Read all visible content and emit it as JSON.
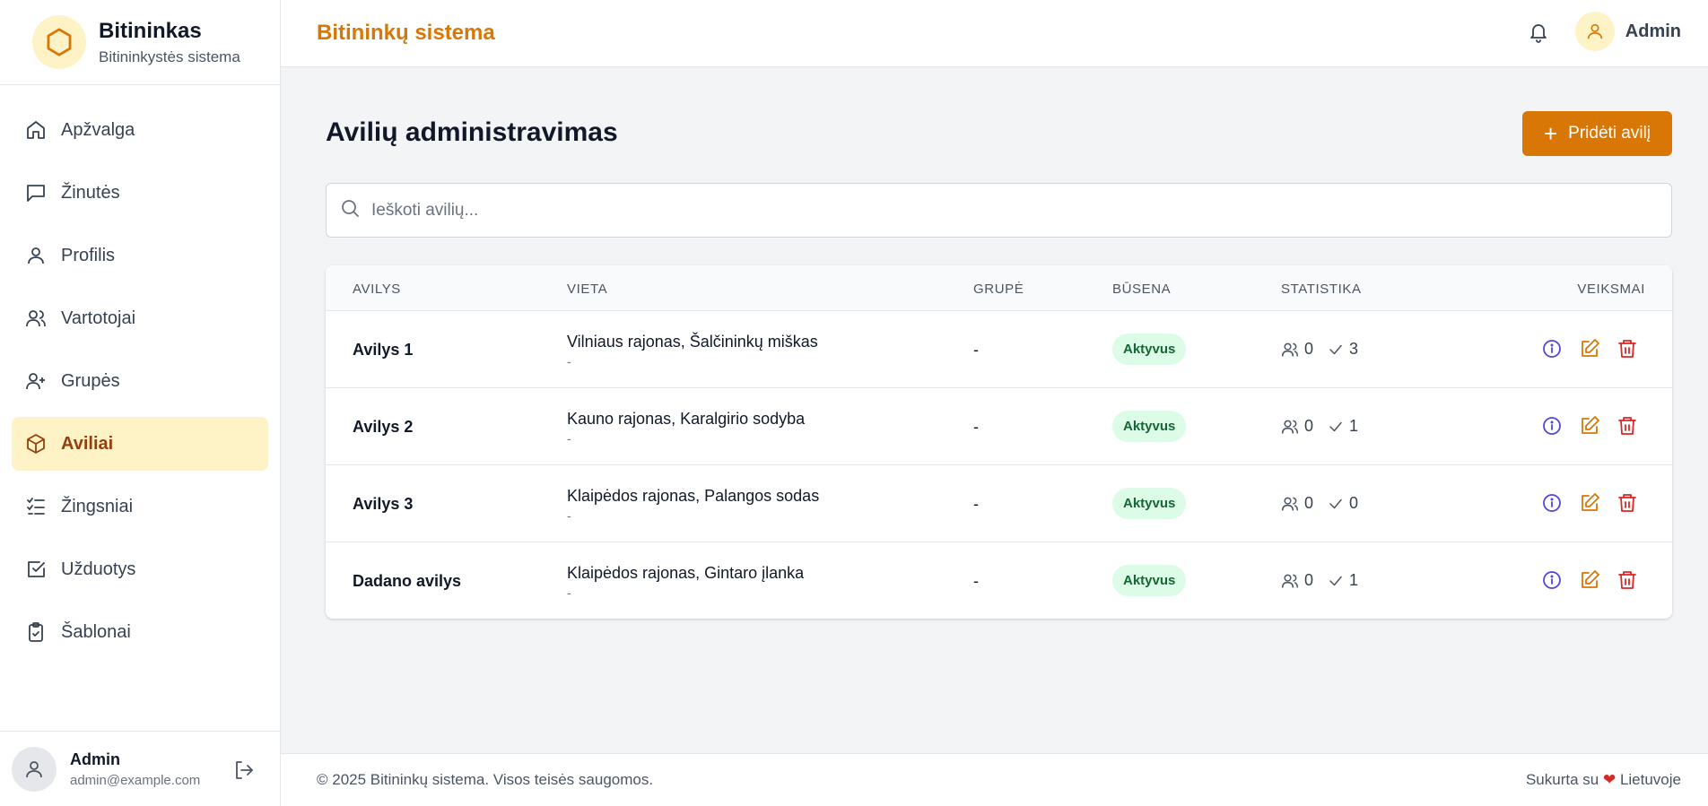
{
  "brand": {
    "name": "Bitininkas",
    "subtitle": "Bitininkystės sistema",
    "accent": "#d97706"
  },
  "sidebar": {
    "items": [
      {
        "label": "Apžvalga",
        "icon": "home-icon",
        "active": false
      },
      {
        "label": "Žinutės",
        "icon": "message-icon",
        "active": false
      },
      {
        "label": "Profilis",
        "icon": "user-icon",
        "active": false
      },
      {
        "label": "Vartotojai",
        "icon": "users-icon",
        "active": false
      },
      {
        "label": "Grupės",
        "icon": "user-plus-icon",
        "active": false
      },
      {
        "label": "Aviliai",
        "icon": "box-icon",
        "active": true
      },
      {
        "label": "Žingsniai",
        "icon": "list-checks-icon",
        "active": false
      },
      {
        "label": "Užduotys",
        "icon": "square-check-icon",
        "active": false
      },
      {
        "label": "Šablonai",
        "icon": "clipboard-check-icon",
        "active": false
      }
    ],
    "user": {
      "name": "Admin",
      "email": "admin@example.com"
    }
  },
  "header": {
    "title": "Bitininkų sistema",
    "username": "Admin"
  },
  "main": {
    "title": "Avilių administravimas",
    "add_button": "Pridėti avilį",
    "search_placeholder": "Ieškoti avilių...",
    "columns": [
      "Avilys",
      "Vieta",
      "Grupė",
      "Būsena",
      "Statistika",
      "Veiksmai"
    ],
    "rows": [
      {
        "name": "Avilys 1",
        "location": "Vilniaus rajonas, Šalčininkų miškas",
        "location_sub": "-",
        "group": "-",
        "status": "Aktyvus",
        "members": "0",
        "tasks": "3"
      },
      {
        "name": "Avilys 2",
        "location": "Kauno rajonas, Karalgirio sodyba",
        "location_sub": "-",
        "group": "-",
        "status": "Aktyvus",
        "members": "0",
        "tasks": "1"
      },
      {
        "name": "Avilys 3",
        "location": "Klaipėdos rajonas, Palangos sodas",
        "location_sub": "-",
        "group": "-",
        "status": "Aktyvus",
        "members": "0",
        "tasks": "0"
      },
      {
        "name": "Dadano avilys",
        "location": "Klaipėdos rajonas, Gintaro įlanka",
        "location_sub": "-",
        "group": "-",
        "status": "Aktyvus",
        "members": "0",
        "tasks": "1"
      }
    ]
  },
  "footer": {
    "copyright": "© 2025 Bitininkų sistema. Visos teisės saugomos.",
    "made_prefix": "Sukurta su",
    "made_suffix": "Lietuvoje"
  }
}
